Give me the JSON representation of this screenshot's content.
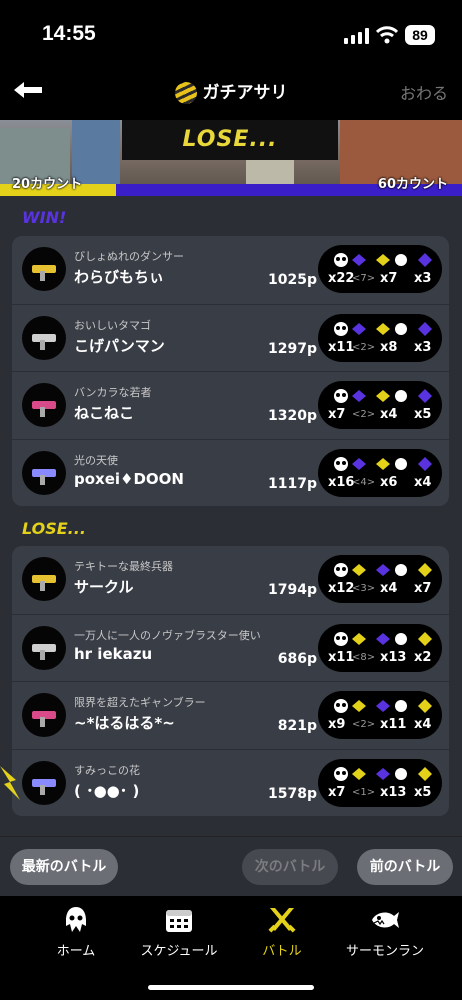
{
  "status_bar": {
    "time": "14:55",
    "battery": "89"
  },
  "nav": {
    "title": "ガチアサリ",
    "close_label": "おわる"
  },
  "banner": {
    "result": "LOSE...",
    "left_count": "20カウント",
    "right_count": "60カウント"
  },
  "teams": {
    "win": {
      "label": "WIN!",
      "players": [
        {
          "byname": "びしょぬれのダンサー",
          "name": "わらびもちぃ",
          "points": "1025p",
          "kills": "x22",
          "assists": "<7>",
          "specials_used": "x7",
          "special_count": "x3"
        },
        {
          "byname": "おいしいタマゴ",
          "name": "こげパンマン",
          "points": "1297p",
          "kills": "x11",
          "assists": "<2>",
          "specials_used": "x8",
          "special_count": "x3"
        },
        {
          "byname": "バンカラな若者",
          "name": "ねこねこ",
          "points": "1320p",
          "kills": "x7",
          "assists": "<2>",
          "specials_used": "x4",
          "special_count": "x5"
        },
        {
          "byname": "光の天使",
          "name": "poxei♦DOON",
          "points": "1117p",
          "kills": "x16",
          "assists": "<4>",
          "specials_used": "x6",
          "special_count": "x4"
        }
      ]
    },
    "lose": {
      "label": "LOSE...",
      "players": [
        {
          "byname": "テキトーな最終兵器",
          "name": "サークル",
          "points": "1794p",
          "kills": "x12",
          "assists": "<3>",
          "specials_used": "x4",
          "special_count": "x7"
        },
        {
          "byname": "一万人に一人のノヴァブラスター使い",
          "name": "hr iekazu",
          "points": "686p",
          "kills": "x11",
          "assists": "<8>",
          "specials_used": "x13",
          "special_count": "x2"
        },
        {
          "byname": "限界を超えたギャンブラー",
          "name": "~*はるはる*~",
          "points": "821p",
          "kills": "x9",
          "assists": "<2>",
          "specials_used": "x11",
          "special_count": "x4"
        },
        {
          "byname": "すみっこの花",
          "name": "( ･●●･ )",
          "points": "1578p",
          "kills": "x7",
          "assists": "<1>",
          "specials_used": "x13",
          "special_count": "x5"
        }
      ]
    }
  },
  "footer": {
    "latest": "最新のバトル",
    "next": "次のバトル",
    "prev": "前のバトル"
  },
  "tabs": [
    {
      "label": "ホーム",
      "icon": "squid-icon"
    },
    {
      "label": "スケジュール",
      "icon": "calendar-icon"
    },
    {
      "label": "バトル",
      "icon": "battle-icon"
    },
    {
      "label": "サーモンラン",
      "icon": "salmon-icon"
    }
  ],
  "colors": {
    "win": "#5a33e0",
    "lose": "#e4d21a",
    "background": "#2b2e35",
    "card": "#393d46"
  }
}
